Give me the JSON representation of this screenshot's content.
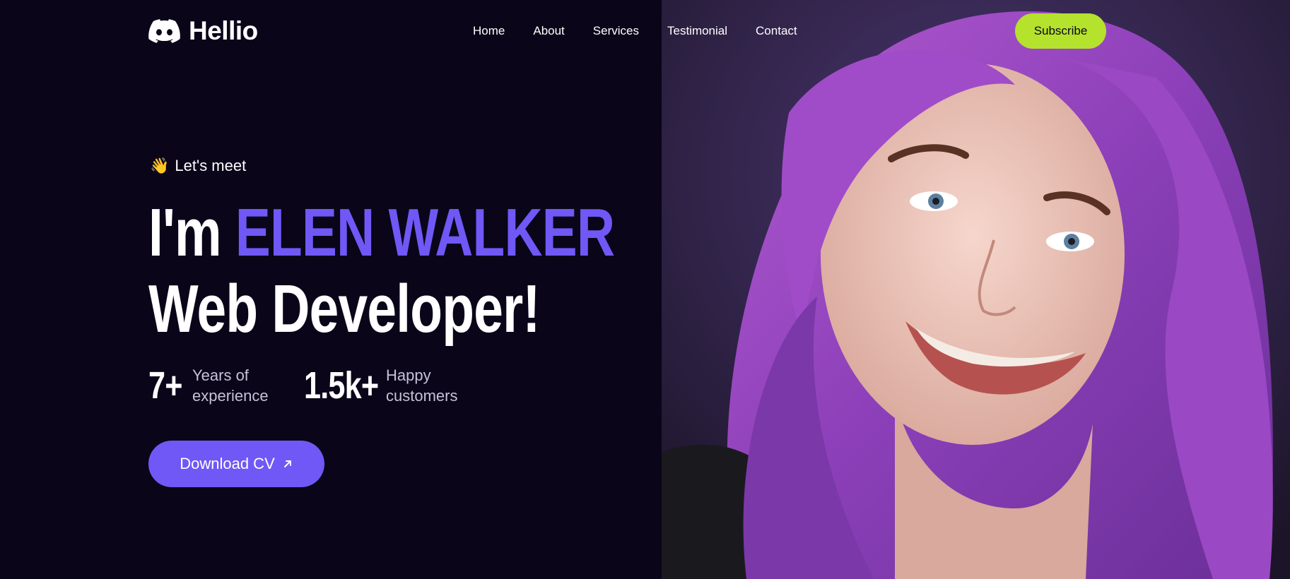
{
  "brand": {
    "name": "Hellio",
    "logo_icon": "discord-icon"
  },
  "nav": {
    "items": [
      {
        "label": "Home"
      },
      {
        "label": "About"
      },
      {
        "label": "Services"
      },
      {
        "label": "Testimonial"
      },
      {
        "label": "Contact"
      }
    ],
    "cta_label": "Subscribe"
  },
  "hero": {
    "greeting_icon": "👋",
    "greeting": "Let's meet",
    "headline_prefix": "I'm",
    "headline_name": "ELEN WALKER",
    "headline_role": "Web Developer!",
    "stats": [
      {
        "value": "7+",
        "label_line1": "Years of",
        "label_line2": "experience"
      },
      {
        "value": "1.5k+",
        "label_line1": "Happy",
        "label_line2": "customers"
      }
    ],
    "cta_label": "Download CV",
    "cta_icon": "arrow-up-right-icon",
    "photo_alt": "portrait-photo"
  },
  "colors": {
    "background": "#0a0519",
    "accent": "#6f58f5",
    "subscribe": "#b4e22d",
    "text": "#ffffff",
    "muted": "#c6c1d9"
  }
}
